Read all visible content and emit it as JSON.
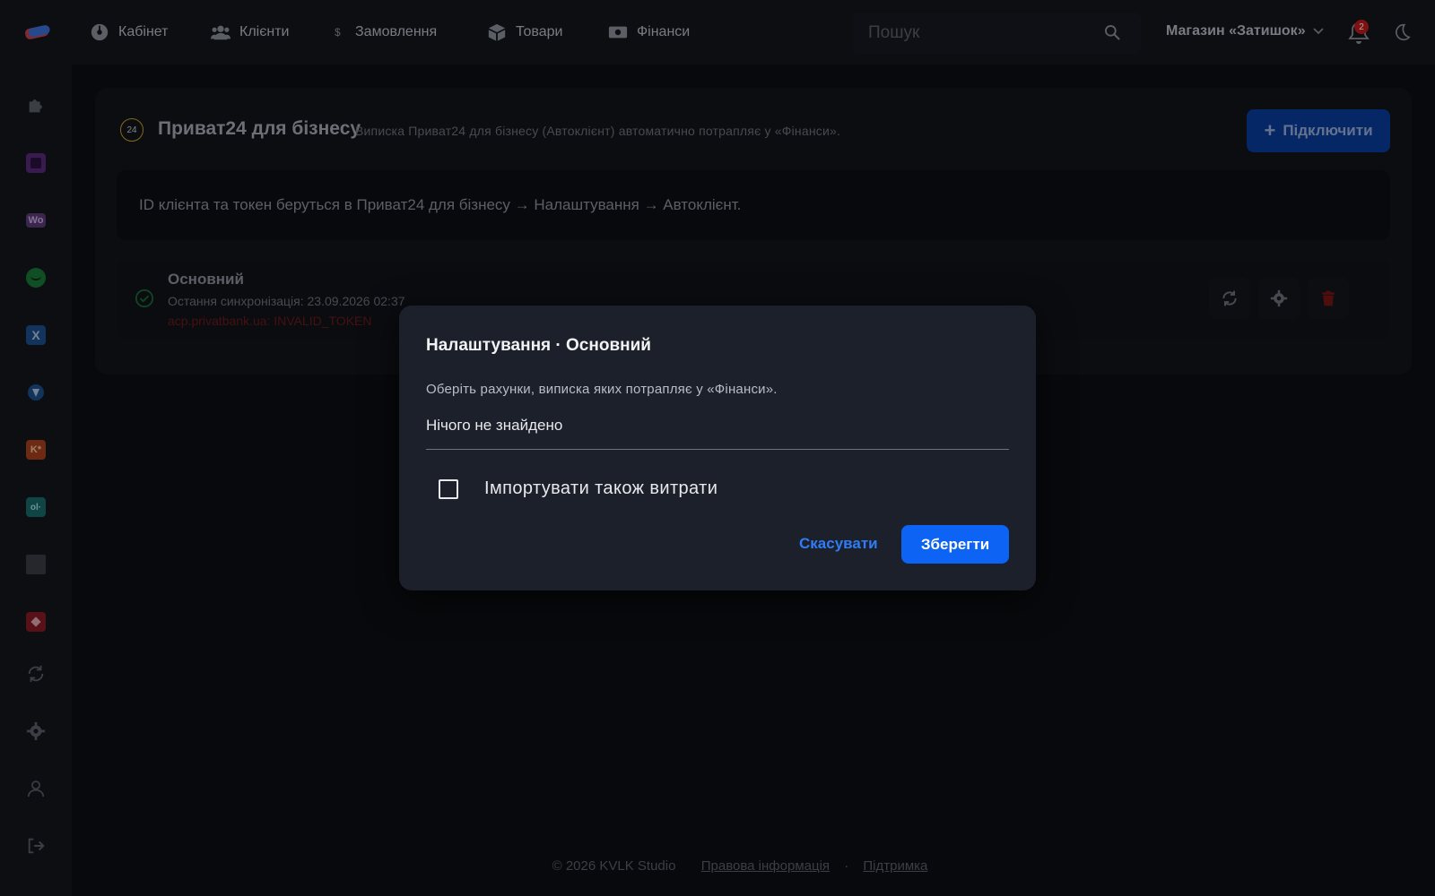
{
  "nav": {
    "items": [
      {
        "label": "Кабінет",
        "icon": "dashboard-icon"
      },
      {
        "label": "Клієнти",
        "icon": "users-icon"
      },
      {
        "label": "Замовлення",
        "icon": "dollar-icon"
      },
      {
        "label": "Товари",
        "icon": "box-icon"
      },
      {
        "label": "Фінанси",
        "icon": "money-icon"
      }
    ],
    "search_placeholder": "Пошук",
    "store_name": "Магазин «Затишок»",
    "notifications_count": "2"
  },
  "integration": {
    "logo_text": "24",
    "title": "Приват24 для бізнесу",
    "subtitle": "Виписка Приват24 для бізнесу (Автоклієнт) автоматично потрапляє у «Фінанси».",
    "connect_label": "Підключити",
    "hint": "ID клієнта та токен беруться в Приват24 для бізнесу → Налаштування → Автоклієнт."
  },
  "account": {
    "name": "Основний",
    "last_sync": "Остання синхронізація: 23.09.2026 02:37",
    "error": "acp.privatbank.ua: INVALID_TOKEN"
  },
  "footer": {
    "copyright": "© 2026 KVLK Studio",
    "legal": "Правова інформація",
    "separator": "·",
    "support": "Підтримка"
  },
  "modal": {
    "title": "Налаштування · Основний",
    "description": "Оберіть рахунки, виписка яких потрапляє у «Фінанси».",
    "empty_text": "Нічого не знайдено",
    "checkbox_label": "Імпортувати також витрати",
    "cancel_label": "Скасувати",
    "save_label": "Зберегти"
  },
  "sidebar": {
    "tiles": {
      "woo": "Wo",
      "x": "X",
      "k": "K*",
      "ol": "ol·"
    }
  },
  "colors": {
    "primary": "#0d63f3",
    "danger": "#c21d1d",
    "success": "#1f9d4a"
  }
}
